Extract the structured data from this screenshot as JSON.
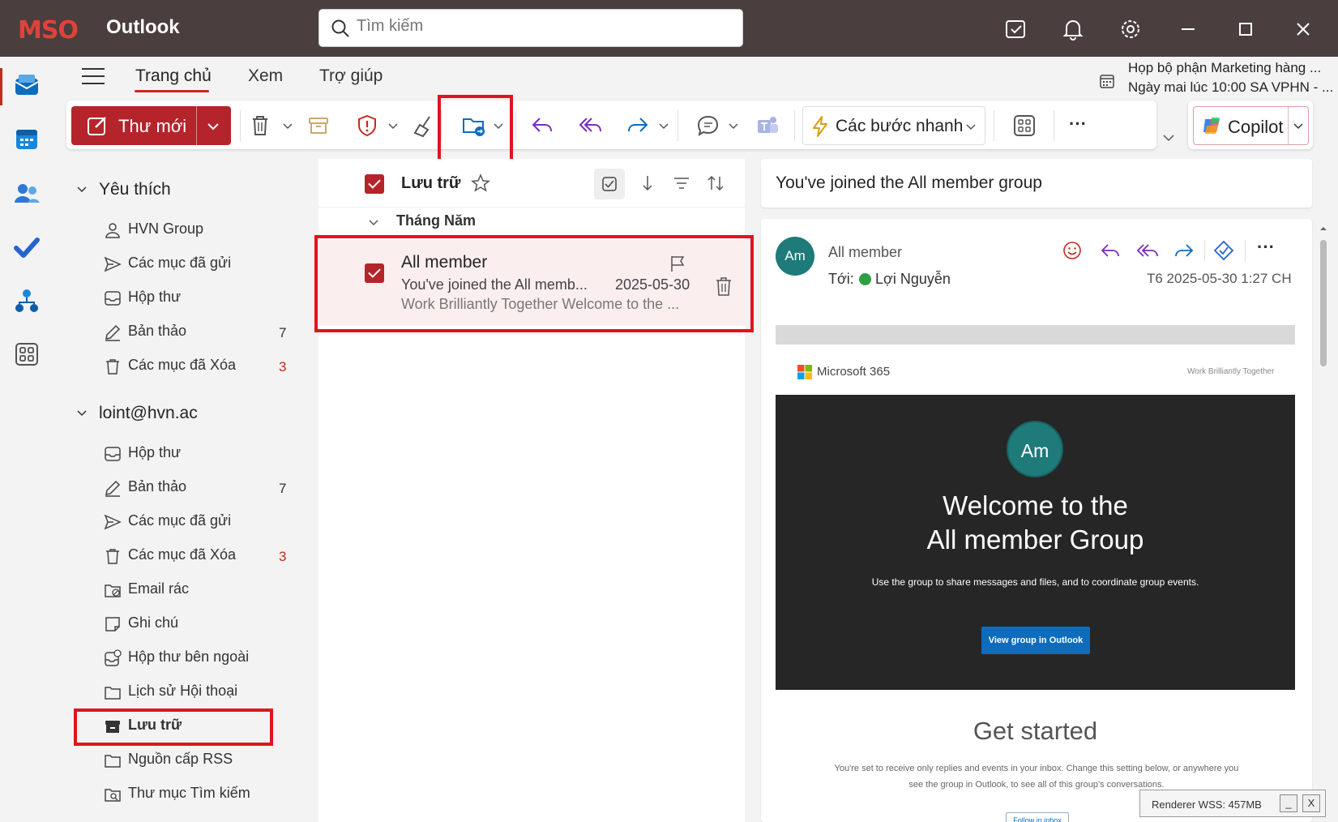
{
  "titlebar": {
    "logo": "MSO",
    "app_title": "Outlook",
    "search_placeholder": "Tìm kiếm",
    "icons": [
      "my-day-icon",
      "bell-icon",
      "gear-icon",
      "minimize-icon",
      "maximize-icon",
      "close-icon"
    ]
  },
  "rail": {
    "items": [
      "mail-icon",
      "calendar-icon",
      "people-icon",
      "todo-icon",
      "org-icon",
      "apps-icon"
    ]
  },
  "ribbon": {
    "tabs": [
      "Trang chủ",
      "Xem",
      "Trợ giúp"
    ],
    "active_tab": "Trang chủ",
    "meeting_title": "Họp bộ phận Marketing hàng ...",
    "meeting_time": "Ngày mai lúc 10:00 SA VPHN - ..."
  },
  "toolbar": {
    "new_mail": "Thư mới",
    "quick_steps": "Các bước nhanh",
    "copilot": "Copilot",
    "more": "···",
    "accent": "#b5242a"
  },
  "folders": {
    "favorites_header": "Yêu thích",
    "favorites": [
      {
        "label": "HVN Group",
        "icon": "person-icon",
        "count": ""
      },
      {
        "label": "Các mục đã gửi",
        "icon": "send-icon",
        "count": ""
      },
      {
        "label": "Hộp thư",
        "icon": "inbox-icon",
        "count": ""
      },
      {
        "label": "Bản thảo",
        "icon": "draft-icon",
        "count": "7"
      },
      {
        "label": "Các mục đã Xóa",
        "icon": "trash-icon",
        "count": "3"
      }
    ],
    "account_header": "loint@hvn.ac",
    "account": [
      {
        "label": "Hộp thư",
        "icon": "inbox-icon",
        "count": ""
      },
      {
        "label": "Bản thảo",
        "icon": "draft-icon",
        "count": "7"
      },
      {
        "label": "Các mục đã gửi",
        "icon": "send-icon",
        "count": ""
      },
      {
        "label": "Các mục đã Xóa",
        "icon": "trash-icon",
        "count": "3"
      },
      {
        "label": "Email rác",
        "icon": "junk-icon",
        "count": ""
      },
      {
        "label": "Ghi chú",
        "icon": "note-icon",
        "count": ""
      },
      {
        "label": "Hộp thư bên ngoài",
        "icon": "outbox-icon",
        "count": ""
      },
      {
        "label": "Lịch sử Hội thoại",
        "icon": "folder-icon",
        "count": ""
      },
      {
        "label": "Lưu trữ",
        "icon": "archive-icon",
        "count": ""
      },
      {
        "label": "Nguồn cấp RSS",
        "icon": "folder-icon",
        "count": ""
      },
      {
        "label": "Thư mục Tìm kiếm",
        "icon": "search-folder-icon",
        "count": ""
      }
    ]
  },
  "message_list": {
    "folder_title": "Lưu trữ",
    "group_label": "Tháng Năm",
    "messages": [
      {
        "sender": "All member",
        "subject": "You've joined the All memb...",
        "date": "2025-05-30",
        "preview": "Work Brilliantly Together Welcome to the ..."
      }
    ]
  },
  "reading": {
    "header": "You've joined the All member group",
    "avatar_initials": "Am",
    "from": "All member",
    "to_label": "Tới:",
    "to_name": "Lợi Nguyễn",
    "date": "T6 2025-05-30 1:27 CH",
    "brand": "Microsoft 365",
    "tagline": "Work Brilliantly Together",
    "hero_line1": "Welcome to the",
    "hero_line2": "All member Group",
    "hero_desc": "Use the group to share messages and files, and to coordinate group events.",
    "hero_button": "View group in Outlook",
    "get_started": "Get started",
    "get_started_desc": "You're set to receive only replies and events in your inbox. Change this setting below, or anywhere you see the group in Outlook, to see all of this group's conversations.",
    "follow_button": "Follow in inbox"
  },
  "renderer": {
    "text": "Renderer WSS: 457MB",
    "min": "_",
    "close": "X"
  }
}
